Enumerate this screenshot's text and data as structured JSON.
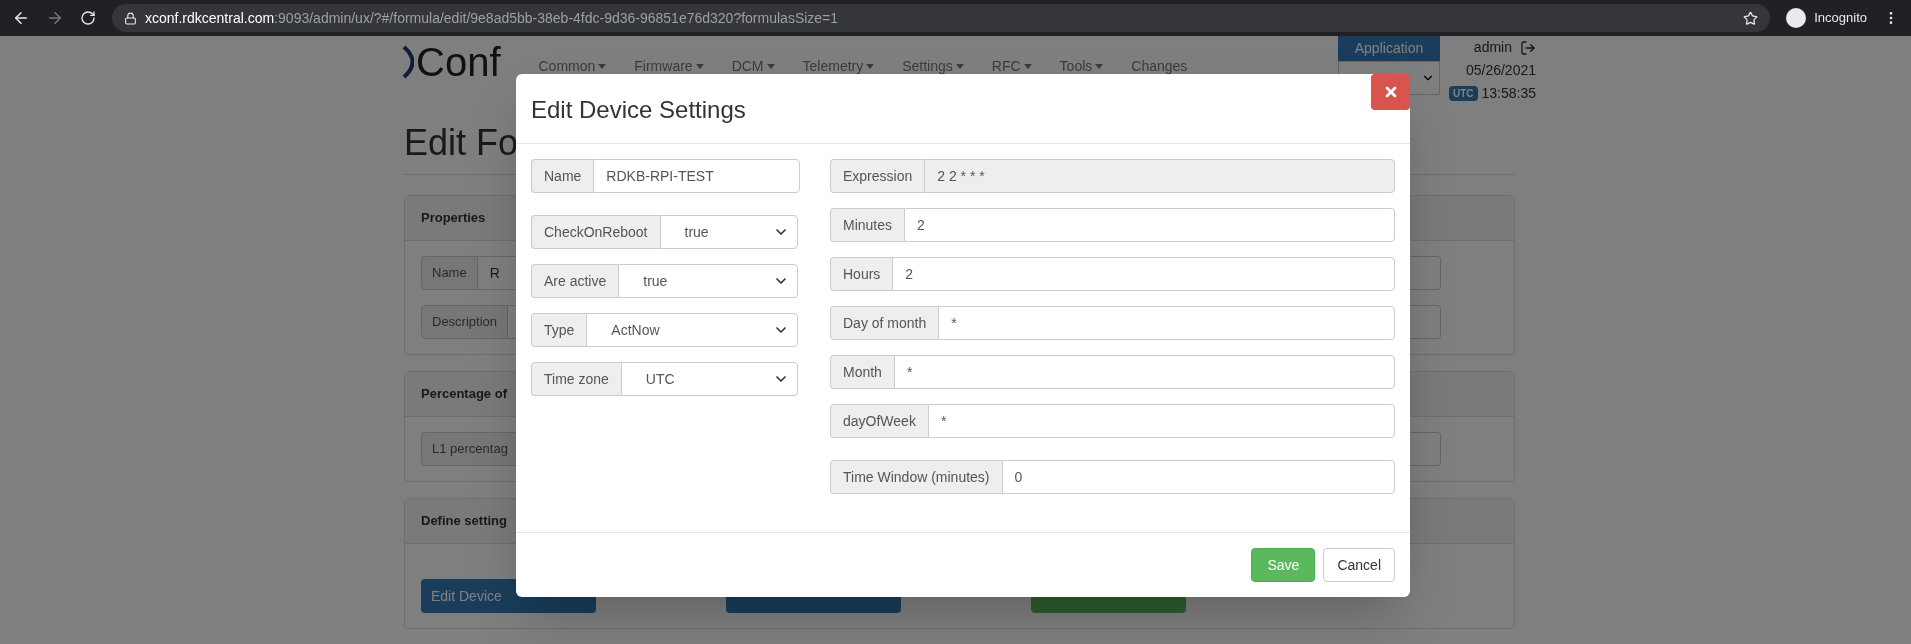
{
  "browser": {
    "url_host": "xconf.rdkcentral.com",
    "url_path": ":9093/admin/ux/?#/formula/edit/9e8ad5bb-38eb-4fdc-9d36-96851e76d320?formulasSize=1",
    "profile": "Incognito"
  },
  "header": {
    "logo": "Conf",
    "nav": [
      {
        "label": "Common",
        "dropdown": true
      },
      {
        "label": "Firmware",
        "dropdown": true
      },
      {
        "label": "DCM",
        "dropdown": true
      },
      {
        "label": "Telemetry",
        "dropdown": true
      },
      {
        "label": "Settings",
        "dropdown": true
      },
      {
        "label": "RFC",
        "dropdown": true
      },
      {
        "label": "Tools",
        "dropdown": true
      },
      {
        "label": "Changes",
        "dropdown": false
      }
    ],
    "application_button": "Application",
    "user": "admin",
    "date": "05/26/2021",
    "timezone": "UTC",
    "time": "13:58:35"
  },
  "page": {
    "title": "Edit Fo",
    "panels": [
      {
        "title": "Properties",
        "fields": [
          {
            "label": "Name",
            "value": "R"
          },
          {
            "label": "Description"
          }
        ]
      },
      {
        "title": "Percentage of",
        "fields": [
          {
            "label": "L1 percentag"
          }
        ]
      },
      {
        "title": "Define setting",
        "buttons": [
          {
            "kind": "primary",
            "label": "Edit Device"
          },
          {
            "kind": "primary"
          },
          {
            "kind": "success"
          }
        ]
      }
    ]
  },
  "modal": {
    "title": "Edit Device Settings",
    "left_groups": [
      [
        {
          "kind": "text",
          "label": "Name",
          "value": "RDKB-RPI-TEST"
        }
      ],
      [
        {
          "kind": "select",
          "label": "CheckOnReboot",
          "value": "true"
        },
        {
          "kind": "select",
          "label": "Are active",
          "value": "true"
        },
        {
          "kind": "select",
          "label": "Type",
          "value": "ActNow"
        },
        {
          "kind": "select",
          "label": "Time zone",
          "value": "UTC"
        }
      ]
    ],
    "right_groups": [
      [
        {
          "kind": "readonly",
          "label": "Expression",
          "value": "2 2 * * *"
        },
        {
          "kind": "text",
          "label": "Minutes",
          "value": "2"
        },
        {
          "kind": "text",
          "label": "Hours",
          "value": "2"
        },
        {
          "kind": "text",
          "label": "Day of month",
          "value": "*"
        },
        {
          "kind": "text",
          "label": "Month",
          "value": "*"
        },
        {
          "kind": "text",
          "label": "dayOfWeek",
          "value": "*"
        }
      ],
      [
        {
          "kind": "text",
          "label": "Time Window (minutes)",
          "value": "0"
        }
      ]
    ],
    "save": "Save",
    "cancel": "Cancel"
  }
}
